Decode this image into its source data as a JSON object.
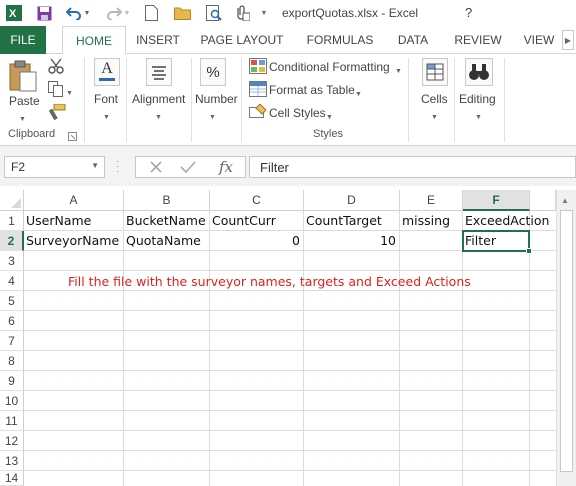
{
  "window": {
    "title": "exportQuotas.xlsx - Excel",
    "help": "?"
  },
  "quick_access": {
    "icons": [
      "excel-logo-icon",
      "save-icon",
      "undo-icon",
      "undo-dropdown-icon",
      "redo-icon",
      "redo-dropdown-icon",
      "new-file-icon",
      "open-folder-icon",
      "print-preview-icon",
      "attach-icon",
      "customize-dropdown-icon"
    ]
  },
  "ribbon_tabs": {
    "file": "FILE",
    "home": "HOME",
    "insert": "INSERT",
    "page_layout": "PAGE LAYOUT",
    "formulas": "FORMULAS",
    "data": "DATA",
    "review": "REVIEW",
    "view": "VIEW"
  },
  "ribbon": {
    "paste": "Paste",
    "clipboard": "Clipboard",
    "font": "Font",
    "alignment": "Alignment",
    "number": "Number",
    "conditional_formatting": "Conditional Formatting",
    "format_as_table": "Format as Table",
    "cell_styles": "Cell Styles",
    "styles": "Styles",
    "cells": "Cells",
    "editing": "Editing",
    "percent_symbol": "%",
    "font_letter": "A"
  },
  "formula_bar": {
    "name_box": "F2",
    "fx_label": "fx",
    "value": "Filter"
  },
  "sheet": {
    "columns": [
      "A",
      "B",
      "C",
      "D",
      "E",
      "F"
    ],
    "rows": [
      "1",
      "2",
      "3",
      "4",
      "5",
      "6",
      "7",
      "8",
      "9",
      "10",
      "11",
      "12",
      "13",
      "14"
    ],
    "selected_cell": "F2",
    "cells": {
      "A1": "UserName",
      "B1": "BucketName",
      "C1": "CountCurr",
      "D1": "CountTarget",
      "E1": "missing",
      "F1": "ExceedAction",
      "A2": "SurveyorName",
      "B2": "QuotaName",
      "C2": "0",
      "D2": "10",
      "F2": "Filter"
    },
    "note": "Fill the file with the surveyor names, targets and Exceed Actions",
    "note_color": "#e02020"
  },
  "colors": {
    "accent": "#217346"
  }
}
